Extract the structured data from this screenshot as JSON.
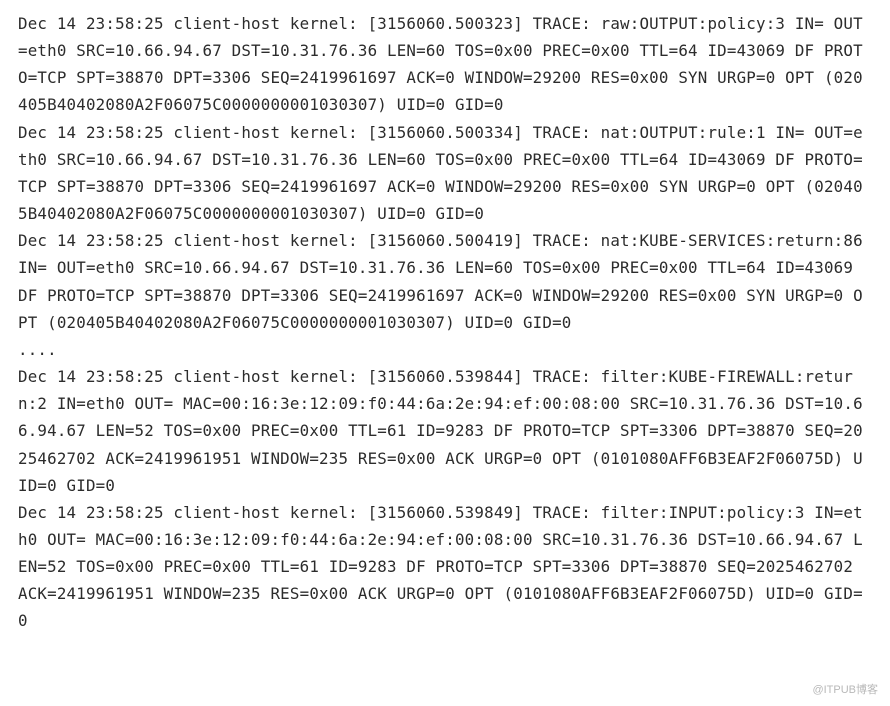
{
  "log": {
    "lines": [
      "Dec 14 23:58:25 client-host kernel: [3156060.500323] TRACE: raw:OUTPUT:policy:3 IN= OUT=eth0 SRC=10.66.94.67 DST=10.31.76.36 LEN=60 TOS=0x00 PREC=0x00 TTL=64 ID=43069 DF PROTO=TCP SPT=38870 DPT=3306 SEQ=2419961697 ACK=0 WINDOW=29200 RES=0x00 SYN URGP=0 OPT (020405B40402080A2F06075C0000000001030307) UID=0 GID=0",
      "Dec 14 23:58:25 client-host kernel: [3156060.500334] TRACE: nat:OUTPUT:rule:1 IN= OUT=eth0 SRC=10.66.94.67 DST=10.31.76.36 LEN=60 TOS=0x00 PREC=0x00 TTL=64 ID=43069 DF PROTO=TCP SPT=38870 DPT=3306 SEQ=2419961697 ACK=0 WINDOW=29200 RES=0x00 SYN URGP=0 OPT (020405B40402080A2F06075C0000000001030307) UID=0 GID=0",
      "Dec 14 23:58:25 client-host kernel: [3156060.500419] TRACE: nat:KUBE-SERVICES:return:86 IN= OUT=eth0 SRC=10.66.94.67 DST=10.31.76.36 LEN=60 TOS=0x00 PREC=0x00 TTL=64 ID=43069 DF PROTO=TCP SPT=38870 DPT=3306 SEQ=2419961697 ACK=0 WINDOW=29200 RES=0x00 SYN URGP=0 OPT (020405B40402080A2F06075C0000000001030307) UID=0 GID=0",
      "....",
      "Dec 14 23:58:25 client-host kernel: [3156060.539844] TRACE: filter:KUBE-FIREWALL:return:2 IN=eth0 OUT= MAC=00:16:3e:12:09:f0:44:6a:2e:94:ef:00:08:00 SRC=10.31.76.36 DST=10.66.94.67 LEN=52 TOS=0x00 PREC=0x00 TTL=61 ID=9283 DF PROTO=TCP SPT=3306 DPT=38870 SEQ=2025462702 ACK=2419961951 WINDOW=235 RES=0x00 ACK URGP=0 OPT (0101080AFF6B3EAF2F06075D) UID=0 GID=0",
      "Dec 14 23:58:25 client-host kernel: [3156060.539849] TRACE: filter:INPUT:policy:3 IN=eth0 OUT= MAC=00:16:3e:12:09:f0:44:6a:2e:94:ef:00:08:00 SRC=10.31.76.36 DST=10.66.94.67 LEN=52 TOS=0x00 PREC=0x00 TTL=61 ID=9283 DF PROTO=TCP SPT=3306 DPT=38870 SEQ=2025462702 ACK=2419961951 WINDOW=235 RES=0x00 ACK URGP=0 OPT (0101080AFF6B3EAF2F06075D) UID=0 GID=0"
    ]
  },
  "watermark": "@ITPUB博客"
}
